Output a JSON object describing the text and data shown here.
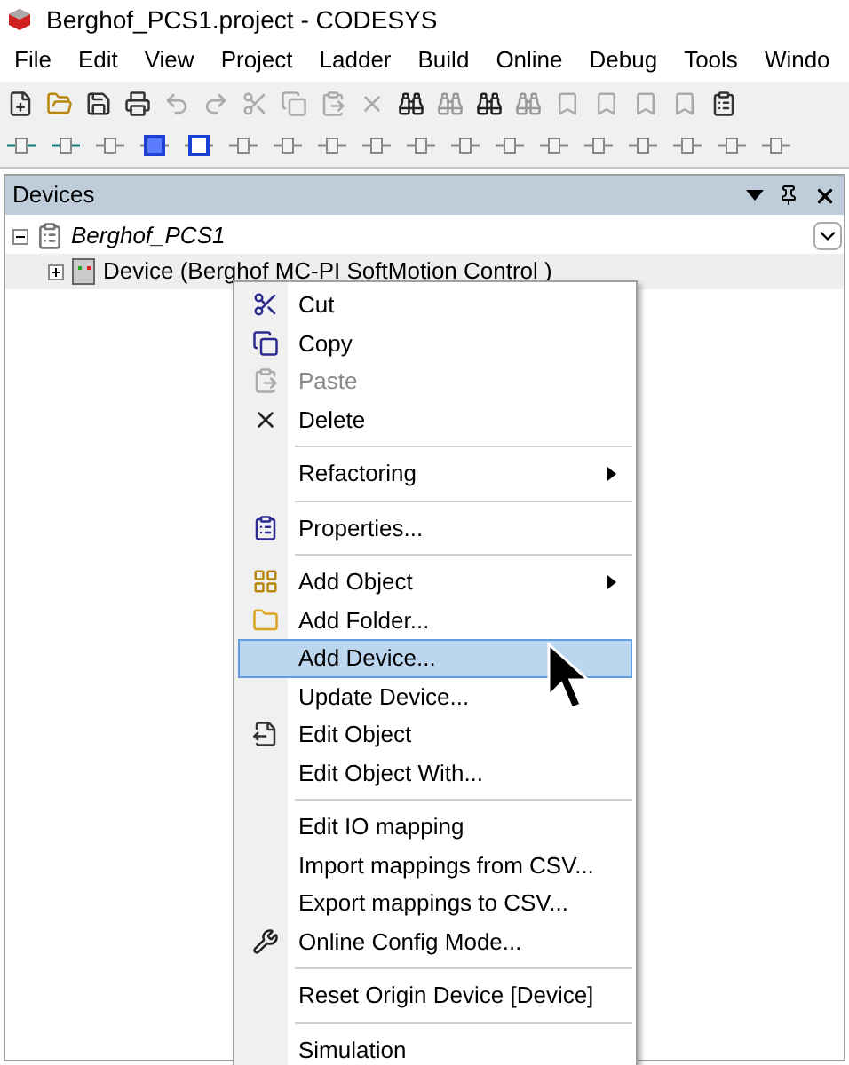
{
  "window": {
    "title": "Berghof_PCS1.project - CODESYS"
  },
  "menu_bar": [
    "File",
    "Edit",
    "View",
    "Project",
    "Ladder",
    "Build",
    "Online",
    "Debug",
    "Tools",
    "Windo"
  ],
  "devices_panel": {
    "title": "Devices",
    "tree": [
      {
        "label": "Berghof_PCS1",
        "expanded": true,
        "children": [
          {
            "label": "Device (Berghof MC-PI SoftMotion Control )",
            "expanded": false
          }
        ]
      }
    ]
  },
  "context_menu": [
    {
      "kind": "item",
      "label": "Cut",
      "disabled": false,
      "submenu": false,
      "selected": false
    },
    {
      "kind": "item",
      "label": "Copy",
      "disabled": false,
      "submenu": false,
      "selected": false
    },
    {
      "kind": "item",
      "label": "Paste",
      "disabled": true,
      "submenu": false,
      "selected": false
    },
    {
      "kind": "item",
      "label": "Delete",
      "disabled": false,
      "submenu": false,
      "selected": false
    },
    {
      "kind": "separator"
    },
    {
      "kind": "item",
      "label": "Refactoring",
      "disabled": false,
      "submenu": true,
      "selected": false
    },
    {
      "kind": "separator"
    },
    {
      "kind": "item",
      "label": "Properties...",
      "disabled": false,
      "submenu": false,
      "selected": false
    },
    {
      "kind": "separator"
    },
    {
      "kind": "item",
      "label": "Add Object",
      "disabled": false,
      "submenu": true,
      "selected": false
    },
    {
      "kind": "item",
      "label": "Add Folder...",
      "disabled": false,
      "submenu": false,
      "selected": false
    },
    {
      "kind": "item",
      "label": "Add Device...",
      "disabled": false,
      "submenu": false,
      "selected": true
    },
    {
      "kind": "item",
      "label": "Update Device...",
      "disabled": false,
      "submenu": false,
      "selected": false
    },
    {
      "kind": "item",
      "label": "Edit Object",
      "disabled": false,
      "submenu": false,
      "selected": false
    },
    {
      "kind": "item",
      "label": "Edit Object With...",
      "disabled": false,
      "submenu": false,
      "selected": false
    },
    {
      "kind": "separator"
    },
    {
      "kind": "item",
      "label": "Edit IO mapping",
      "disabled": false,
      "submenu": false,
      "selected": false
    },
    {
      "kind": "item",
      "label": "Import mappings from CSV...",
      "disabled": false,
      "submenu": false,
      "selected": false
    },
    {
      "kind": "item",
      "label": "Export mappings to CSV...",
      "disabled": false,
      "submenu": false,
      "selected": false
    },
    {
      "kind": "item",
      "label": "Online Config Mode...",
      "disabled": false,
      "submenu": false,
      "selected": false
    },
    {
      "kind": "separator"
    },
    {
      "kind": "item",
      "label": "Reset Origin Device [Device]",
      "disabled": false,
      "submenu": false,
      "selected": false
    },
    {
      "kind": "separator"
    },
    {
      "kind": "item",
      "label": "Simulation",
      "disabled": false,
      "submenu": false,
      "selected": false
    }
  ]
}
